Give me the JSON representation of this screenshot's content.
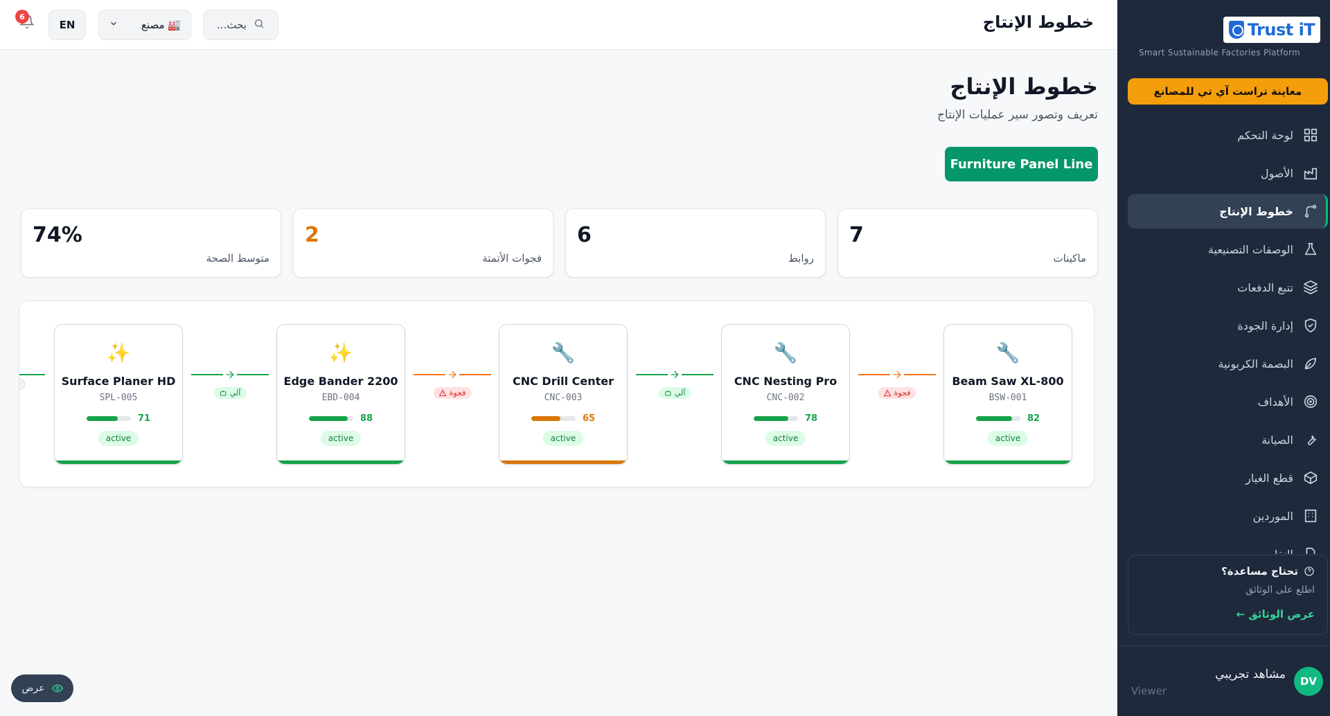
{
  "brand": {
    "logo_text": "Trust iT",
    "tagline": "Smart Sustainable Factories Platform",
    "demo_label": "معاينة تراست آي تي للمصانع"
  },
  "sidebar": {
    "items": [
      {
        "label": "لوحة التحكم",
        "icon": "dashboard-icon"
      },
      {
        "label": "الأصول",
        "icon": "factory-icon"
      },
      {
        "label": "خطوط الإنتاج",
        "icon": "route-icon",
        "active": true
      },
      {
        "label": "الوصفات التصنيعية",
        "icon": "flask-icon"
      },
      {
        "label": "تتبع الدفعات",
        "icon": "layers-icon"
      },
      {
        "label": "إدارة الجودة",
        "icon": "shield-check-icon"
      },
      {
        "label": "البصمة الكربونية",
        "icon": "leaf-icon"
      },
      {
        "label": "الأهداف",
        "icon": "target-icon"
      },
      {
        "label": "الصيانة",
        "icon": "wrench-icon"
      },
      {
        "label": "قطع الغيار",
        "icon": "package-icon"
      },
      {
        "label": "الموردين",
        "icon": "building-icon"
      },
      {
        "label": "النقل",
        "icon": "file-icon"
      }
    ],
    "help": {
      "title": "تحتاج مساعدة؟",
      "subtitle": "اطلع على الوثائق",
      "link": "عرض الوثائق ←"
    },
    "user": {
      "initials": "DV",
      "name": "مشاهد تجريبي",
      "role": "Viewer"
    }
  },
  "header": {
    "title": "خطوط الإنتاج",
    "search_placeholder": "بحث...",
    "factory_label": "🏭 مصنع",
    "lang": "EN",
    "notifications": "6"
  },
  "page": {
    "title": "خطوط الإنتاج",
    "subtitle": "تعريف وتصور سير عمليات الإنتاج",
    "line_button": "Furniture Panel Line"
  },
  "stats": [
    {
      "value": "7",
      "label": "ماكينات",
      "color": "#111827"
    },
    {
      "value": "6",
      "label": "روابط",
      "color": "#111827"
    },
    {
      "value": "2",
      "label": "فجوات الأتمتة",
      "color": "#d97706"
    },
    {
      "value": "74%",
      "label": "متوسط الصحة",
      "color": "#111827"
    }
  ],
  "machines": [
    {
      "name": "Beam Saw XL-800",
      "code": "BSW-001",
      "health": 82,
      "status": "active",
      "icon": "🔧",
      "color": "#16a34a"
    },
    {
      "name": "CNC Nesting Pro",
      "code": "CNC-002",
      "health": 78,
      "status": "active",
      "icon": "🔧",
      "color": "#16a34a"
    },
    {
      "name": "CNC Drill Center",
      "code": "CNC-003",
      "health": 65,
      "status": "active",
      "icon": "🔧",
      "color": "#d97706"
    },
    {
      "name": "Edge Bander 2200",
      "code": "EBD-004",
      "health": 88,
      "status": "active",
      "icon": "✨",
      "color": "#16a34a"
    },
    {
      "name": "Surface Planer HD",
      "code": "SPL-005",
      "health": 71,
      "status": "active",
      "icon": "✨",
      "color": "#16a34a"
    }
  ],
  "connections": [
    {
      "label": "فجوة",
      "type": "gap",
      "color": "#f97316",
      "bg": "#fee2e2",
      "text_color": "#dc2626"
    },
    {
      "label": "آلي",
      "type": "auto",
      "color": "#16a34a",
      "bg": "#dcfce7",
      "text_color": "#15803d"
    },
    {
      "label": "فجوة",
      "type": "gap",
      "color": "#f97316",
      "bg": "#fee2e2",
      "text_color": "#dc2626"
    },
    {
      "label": "آلي",
      "type": "auto",
      "color": "#16a34a",
      "bg": "#dcfce7",
      "text_color": "#15803d"
    }
  ],
  "view_toggle": "عرض"
}
